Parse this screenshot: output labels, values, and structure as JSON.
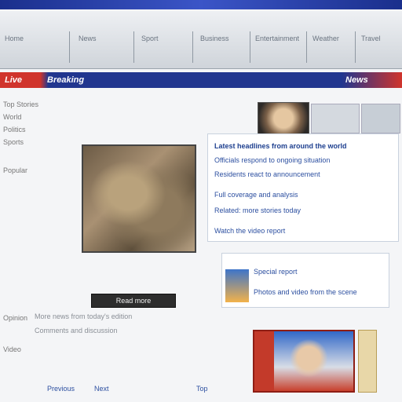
{
  "nav": {
    "items": [
      "Home",
      "News",
      "Sport",
      "Business",
      "Entertainment",
      "Weather",
      "Travel"
    ]
  },
  "banner": {
    "left": "Live",
    "center": "Breaking",
    "right": "News"
  },
  "sidebar": {
    "items": [
      "Top Stories",
      "World",
      "Politics",
      "Sports",
      "Opinion",
      "Video"
    ],
    "section_label": "Popular"
  },
  "story": {
    "headline": "Latest headlines from around the world",
    "lines": [
      "Officials respond to ongoing situation",
      "Residents react to announcement",
      "Full coverage and analysis",
      "Related: more stories today",
      "Watch the video report"
    ],
    "button": "Read more"
  },
  "promo": {
    "lines": [
      "Special report",
      "Photos and video from the scene"
    ]
  },
  "bottom": {
    "lines": [
      "More news from today's edition",
      "Comments and discussion"
    ],
    "links": [
      "Previous",
      "Next",
      "Top"
    ]
  },
  "colors": {
    "accent_blue": "#21368f",
    "accent_red": "#d0342c"
  }
}
